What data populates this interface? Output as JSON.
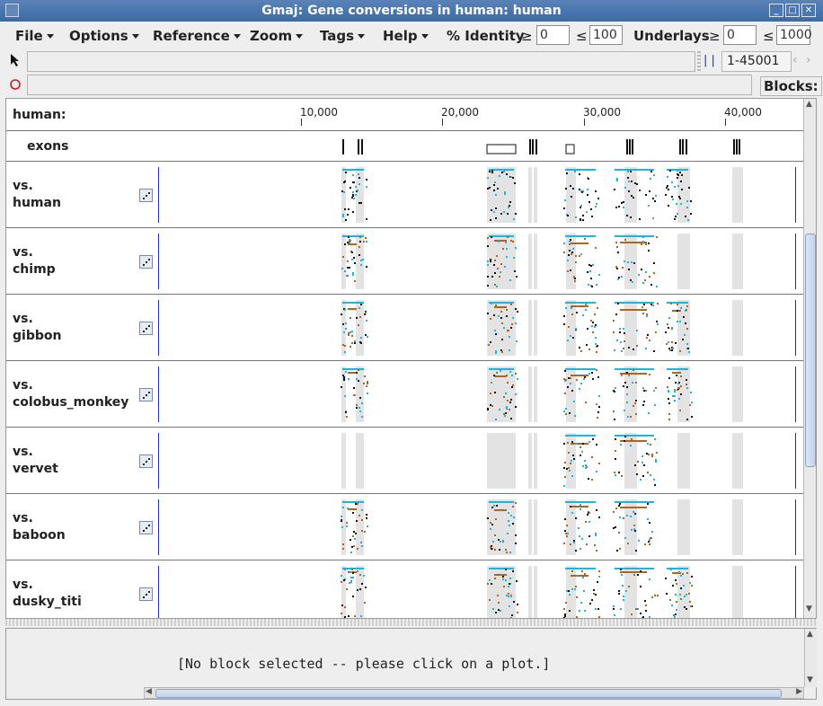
{
  "window": {
    "title": "Gmaj: Gene conversions in human: human",
    "controls": [
      "minimize-icon",
      "maximize-icon",
      "close-icon"
    ]
  },
  "menubar": {
    "menus": [
      "File",
      "Options",
      "Reference",
      "Zoom",
      "Tags",
      "Help"
    ],
    "identity_label": "% Identity",
    "geq": "≥",
    "leq": "≤",
    "identity_min": "0",
    "identity_max": "100",
    "underlays_label": "Underlays",
    "underlays_min": "0",
    "underlays_max": "1000"
  },
  "toolbar": {
    "range": "1-45001",
    "blocks_label": "Blocks:",
    "arrow_tool_icon": "pointer-arrow-icon",
    "mark_tool_icon": "red-circle-icon"
  },
  "header": {
    "reference": "human:",
    "ticks": [
      "10,000",
      "20,000",
      "30,000",
      "40,000"
    ],
    "exons_label": "exons"
  },
  "plots": [
    {
      "vs": "vs.",
      "species": "human"
    },
    {
      "vs": "vs.",
      "species": "chimp"
    },
    {
      "vs": "vs.",
      "species": "gibbon"
    },
    {
      "vs": "vs.",
      "species": "colobus_monkey"
    },
    {
      "vs": "vs.",
      "species": "vervet"
    },
    {
      "vs": "vs.",
      "species": "baboon"
    },
    {
      "vs": "vs.",
      "species": "dusky_titi"
    }
  ],
  "status": {
    "message": "[No block selected -- please click on a plot.]"
  },
  "colors": {
    "titlebar": "#3b6aa5",
    "cyan_match": "#1fb4dc",
    "brown_match": "#b0651e",
    "black_match": "#111111",
    "exon_band": "#e3e3e3",
    "blue_border": "#1f2fb0"
  }
}
